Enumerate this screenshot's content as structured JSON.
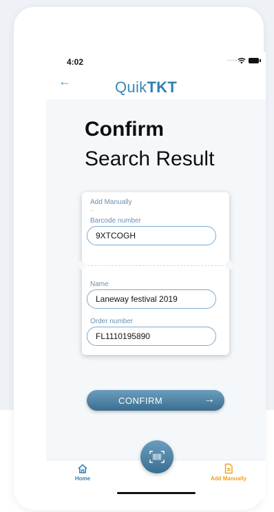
{
  "status": {
    "time": "4:02",
    "signal": "....",
    "wifi_icon": "wifi-icon",
    "battery_icon": "battery-icon"
  },
  "header": {
    "back_icon": "arrow-left-icon",
    "logo_thin": "Quik",
    "logo_bold": "TKT"
  },
  "title": {
    "line1": "Confirm",
    "line2": "Search Result"
  },
  "ticket": {
    "section_label": "Add Manually",
    "section_dash": "--",
    "barcode": {
      "label": "Barcode number",
      "value": "9XTCOGH"
    },
    "name": {
      "label": "Name",
      "value": "Laneway festival 2019"
    },
    "order": {
      "label": "Order number",
      "value": "FL1110195890"
    }
  },
  "confirm": {
    "label": "CONFIRM",
    "arrow": "→"
  },
  "tabbar": {
    "home": {
      "label": "Home",
      "icon": "home-icon"
    },
    "scan": {
      "icon": "barcode-scan-icon"
    },
    "manual": {
      "label": "Add Manually",
      "icon": "document-icon"
    }
  },
  "colors": {
    "accent": "#3a86b8",
    "button": "#4f86a8",
    "active_tab": "#f0a020"
  }
}
